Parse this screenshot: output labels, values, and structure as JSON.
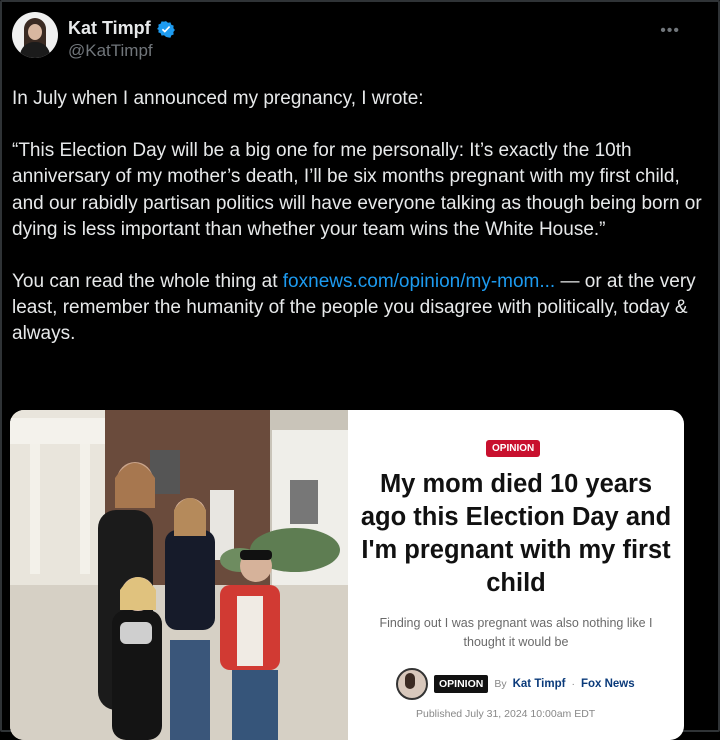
{
  "author": {
    "display_name": "Kat Timpf",
    "handle": "@KatTimpf",
    "verified": true
  },
  "tweet": {
    "para1": "In July when I announced my pregnancy, I wrote:",
    "para2": "“This Election Day will be a big one for me personally: It’s exactly the 10th anniversary of my mother’s death, I’ll be six months pregnant with my first child, and our rabidly partisan politics will have everyone talking as though being born or dying is less important than whether your team wins the White House.”",
    "para3_before": "You can read the whole thing at ",
    "link_text": "foxnews.com/opinion/my-mom...",
    "para3_after": " — or at the very least, remember the humanity of the people you disagree with politically, today & always."
  },
  "card": {
    "tag": "OPINION",
    "headline": "My mom died 10 years ago this Election Day and I'm pregnant with my first child",
    "dek": "Finding out I was pregnant was also nothing like I thought it would be",
    "chip": "OPINION",
    "by": "By",
    "author": "Kat Timpf",
    "separator": "·",
    "outlet": "Fox News",
    "published": "Published July 31, 2024 10:00am EDT"
  },
  "colors": {
    "background": "#000000",
    "text": "#e7e9ea",
    "secondary": "#71767b",
    "link": "#1d9bf0",
    "verified": "#1d9bf0",
    "opinion_red": "#c8102e"
  },
  "icons": {
    "verified": "verified-badge-icon",
    "more": "more-icon"
  }
}
